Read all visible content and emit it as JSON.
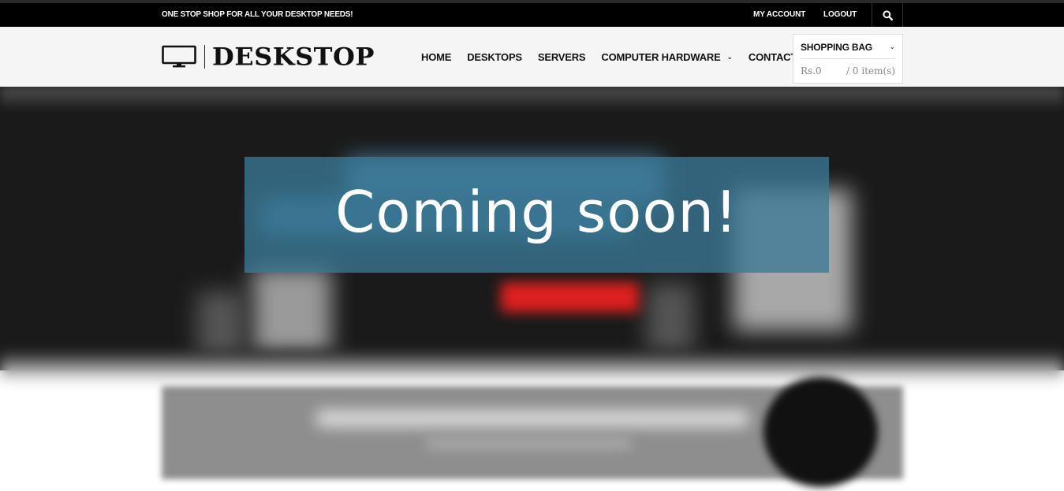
{
  "topbar": {
    "tagline": "ONE STOP SHOP FOR ALL YOUR DESKTOP NEEDS!",
    "my_account": "MY ACCOUNT",
    "logout": "LOGOUT",
    "search_icon": "search-icon"
  },
  "header": {
    "logo_text": "DESKSTOP",
    "logo_icon": "monitor-icon",
    "nav": {
      "home": "HOME",
      "desktops": "DESKTOPS",
      "servers": "SERVERS",
      "computer_hardware": "COMPUTER HARDWARE",
      "contact": "CONTACT"
    },
    "bag": {
      "title": "SHOPPING BAG",
      "total": "Rs.0",
      "items": "/ 0 item(s)"
    }
  },
  "hero": {
    "message": "Coming soon!"
  },
  "colors": {
    "topbar": "#000000",
    "header": "#f5f5f5",
    "overlay": "#3a7896",
    "accent_red": "#e02020"
  }
}
